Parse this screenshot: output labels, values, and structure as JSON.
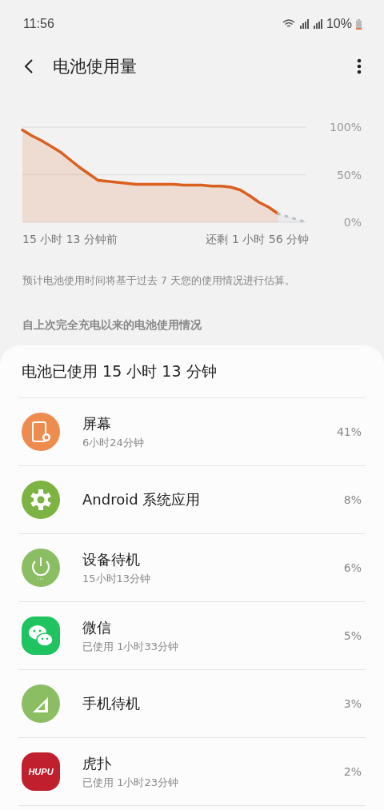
{
  "status_bar": {
    "time": "11:56",
    "battery": "10%"
  },
  "header": {
    "title": "电池使用量"
  },
  "chart": {
    "chart_data": {
      "type": "area",
      "yticks": [
        {
          "value": 0,
          "label": "0%"
        },
        {
          "value": 50,
          "label": "50%"
        },
        {
          "value": 100,
          "label": "100%"
        }
      ],
      "ylim": [
        0,
        100
      ],
      "series": [
        {
          "color": "#d9601f",
          "values": [
            97,
            91,
            86,
            80,
            74,
            66,
            58,
            51,
            44,
            43,
            42,
            41,
            40,
            40,
            40,
            40,
            40,
            39,
            39,
            39,
            38,
            38,
            37,
            34,
            28,
            21,
            16,
            9,
            null,
            null,
            null
          ]
        },
        {
          "color": "#b8bec4",
          "values": [
            null,
            null,
            null,
            null,
            null,
            null,
            null,
            null,
            null,
            null,
            null,
            null,
            null,
            null,
            null,
            null,
            null,
            null,
            null,
            null,
            null,
            null,
            null,
            null,
            null,
            null,
            null,
            9,
            6,
            3,
            0
          ]
        }
      ]
    },
    "start_label": "15 小时 13 分钟前",
    "end_label": "还剩 1 小时 56 分钟"
  },
  "note": "预计电池使用时间将基于过去 7 天您的使用情况进行估算。",
  "section_title": "自上次完全充电以来的电池使用情况",
  "usage": {
    "title": "电池已使用 15 小时 13 分钟",
    "items": [
      {
        "kind": "screen",
        "name": "屏幕",
        "detail": "6小时24分钟",
        "percent": "41%"
      },
      {
        "kind": "system",
        "name": "Android 系统应用",
        "percent": "8%"
      },
      {
        "kind": "standby",
        "name": "设备待机",
        "detail": "15小时13分钟",
        "percent": "6%"
      },
      {
        "kind": "wechat",
        "name": "微信",
        "detail": "已使用 1小时33分钟",
        "percent": "5%"
      },
      {
        "kind": "cell",
        "name": "手机待机",
        "percent": "3%"
      },
      {
        "kind": "hupu",
        "name": "虎扑",
        "icon_text": "HUPU",
        "detail": "已使用 1小时23分钟",
        "percent": "2%"
      }
    ]
  }
}
